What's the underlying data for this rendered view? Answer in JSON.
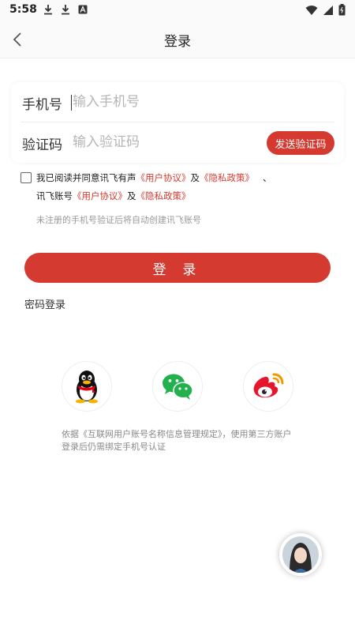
{
  "status_bar": {
    "time": "5:58",
    "left_icons": [
      "download-icon",
      "download-icon",
      "app-notification-icon"
    ],
    "right_icons": [
      "wifi-icon",
      "signal-icon",
      "battery-icon"
    ]
  },
  "app_bar": {
    "title": "登录",
    "back_icon": "chevron-left-icon"
  },
  "form": {
    "phone_label": "手机号",
    "phone_placeholder": "输入手机号",
    "code_label": "验证码",
    "code_placeholder": "输入验证码",
    "send_code_label": "发送验证码"
  },
  "agreement": {
    "line1_prefix": "我已阅读并同意讯飞有声",
    "line1_link1": "《用户协议》",
    "line1_and": "及",
    "line1_link2": "《隐私政策》",
    "line1_sep": "、",
    "line2_prefix": "讯飞账号",
    "line2_link1": "《用户协议》",
    "line2_and": "及",
    "line2_link2": "《隐私政策》",
    "hint": "未注册的手机号验证后将自动创建讯飞账号"
  },
  "login_button_label": "登 录",
  "password_login_label": "密码登录",
  "social": {
    "qq_icon": "qq-penguin-icon",
    "wechat_icon": "wechat-icon",
    "weibo_icon": "weibo-icon"
  },
  "note": "依据《互联网用户账号名称信息管理规定》，使用第三方账户登录后仍需绑定手机号认证",
  "colors": {
    "accent": "#d43a2f",
    "wechat": "#22b14c",
    "weibo": "#e6162d"
  }
}
